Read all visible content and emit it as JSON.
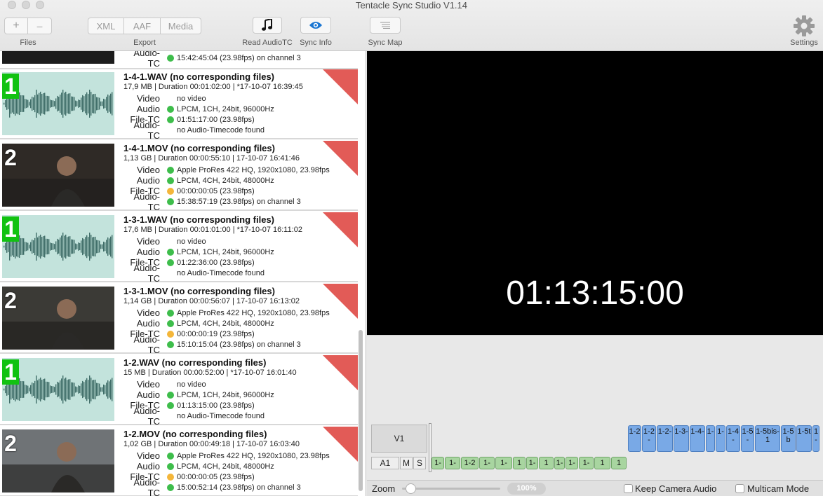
{
  "window": {
    "title": "Tentacle Sync Studio V1.14"
  },
  "toolbar": {
    "files": {
      "add": "+",
      "remove": "–",
      "label": "Files"
    },
    "export": {
      "xml": "XML",
      "aaf": "AAF",
      "media": "Media",
      "label": "Export"
    },
    "read_audiotc": {
      "label": "Read AudioTC",
      "icon": "music-note-icon"
    },
    "sync_info": {
      "label": "Sync Info",
      "icon": "eye-icon"
    },
    "sync_map": {
      "label": "Sync Map",
      "icon": "list-icon"
    },
    "settings": {
      "label": "Settings",
      "icon": "gear-icon"
    }
  },
  "files": {
    "partial": {
      "key": "Audio-TC",
      "value": "15:42:45:04 (23.98fps) on channel 3"
    },
    "items": [
      {
        "badge": "1",
        "kind": "audio",
        "name": "1-4-1.WAV (no corresponding files)",
        "meta": "17,9 MB | Duration 00:01:02:00 | *17-10-07 16:39:45",
        "props": [
          {
            "key": "Video",
            "value": "no video",
            "status": "none"
          },
          {
            "key": "Audio",
            "value": "LPCM, 1CH, 24bit, 96000Hz",
            "status": "green"
          },
          {
            "key": "File-TC",
            "value": "01:51:17:00 (23.98fps)",
            "status": "green"
          },
          {
            "key": "Audio-TC",
            "value": "no Audio-Timecode found",
            "status": "none"
          }
        ]
      },
      {
        "badge": "2",
        "kind": "video",
        "name": "1-4-1.MOV (no corresponding files)",
        "meta": "1,13 GB | Duration 00:00:55:10 | 17-10-07 16:41:46",
        "props": [
          {
            "key": "Video",
            "value": "Apple ProRes 422 HQ, 1920x1080, 23.98fps",
            "status": "green"
          },
          {
            "key": "Audio",
            "value": "LPCM, 4CH, 24bit, 48000Hz",
            "status": "green"
          },
          {
            "key": "File-TC",
            "value": "00:00:00:05 (23.98fps)",
            "status": "orange"
          },
          {
            "key": "Audio-TC",
            "value": "15:38:57:19 (23.98fps) on channel 3",
            "status": "green"
          }
        ]
      },
      {
        "badge": "1",
        "kind": "audio",
        "name": "1-3-1.WAV (no corresponding files)",
        "meta": "17,6 MB | Duration 00:01:01:00 | *17-10-07 16:11:02",
        "props": [
          {
            "key": "Video",
            "value": "no video",
            "status": "none"
          },
          {
            "key": "Audio",
            "value": "LPCM, 1CH, 24bit, 96000Hz",
            "status": "green"
          },
          {
            "key": "File-TC",
            "value": "01:22:36:00 (23.98fps)",
            "status": "green"
          },
          {
            "key": "Audio-TC",
            "value": "no Audio-Timecode found",
            "status": "none"
          }
        ]
      },
      {
        "badge": "2",
        "kind": "video",
        "name": "1-3-1.MOV (no corresponding files)",
        "meta": "1,14 GB | Duration 00:00:56:07 | 17-10-07 16:13:02",
        "props": [
          {
            "key": "Video",
            "value": "Apple ProRes 422 HQ, 1920x1080, 23.98fps",
            "status": "green"
          },
          {
            "key": "Audio",
            "value": "LPCM, 4CH, 24bit, 48000Hz",
            "status": "green"
          },
          {
            "key": "File-TC",
            "value": "00:00:00:19 (23.98fps)",
            "status": "orange"
          },
          {
            "key": "Audio-TC",
            "value": "15:10:15:04 (23.98fps) on channel 3",
            "status": "green"
          }
        ]
      },
      {
        "badge": "1",
        "kind": "audio",
        "name": "1-2.WAV (no corresponding files)",
        "meta": "15 MB | Duration 00:00:52:00 | *17-10-07 16:01:40",
        "props": [
          {
            "key": "Video",
            "value": "no video",
            "status": "none"
          },
          {
            "key": "Audio",
            "value": "LPCM, 1CH, 24bit, 96000Hz",
            "status": "green"
          },
          {
            "key": "File-TC",
            "value": "01:13:15:00 (23.98fps)",
            "status": "green"
          },
          {
            "key": "Audio-TC",
            "value": "no Audio-Timecode found",
            "status": "none"
          }
        ]
      },
      {
        "badge": "2",
        "kind": "video",
        "name": "1-2.MOV (no corresponding files)",
        "meta": "1,02 GB | Duration 00:00:49:18 | 17-10-07 16:03:40",
        "props": [
          {
            "key": "Video",
            "value": "Apple ProRes 422 HQ, 1920x1080, 23.98fps",
            "status": "green"
          },
          {
            "key": "Audio",
            "value": "LPCM, 4CH, 24bit, 48000Hz",
            "status": "green"
          },
          {
            "key": "File-TC",
            "value": "00:00:00:05 (23.98fps)",
            "status": "orange"
          },
          {
            "key": "Audio-TC",
            "value": "15:00:52:14 (23.98fps) on channel 3",
            "status": "green"
          }
        ]
      }
    ]
  },
  "preview": {
    "timecode": "01:13:15:00"
  },
  "timeline": {
    "video_track": "V1",
    "audio_track": "A1",
    "mute": "M",
    "solo": "S",
    "video_clips": [
      "1-2",
      "1-2-",
      "1-2-",
      "1-3-",
      "1-4-",
      "1-",
      "1-",
      "1-4-",
      "1-5-",
      "1-5bis-1",
      "1-5b",
      "1-5t",
      "1-"
    ],
    "audio_clips": [
      "1-",
      "1-",
      "1-2",
      "1-",
      "1-",
      "1",
      "1-",
      "1",
      "1-",
      "1-",
      "1-",
      "1",
      "1"
    ]
  },
  "bottombar": {
    "zoom_label": "Zoom",
    "zoom_value": "100%",
    "zoom_level": 0.04,
    "keep_camera_audio": "Keep Camera Audio",
    "multicam_mode": "Multicam Mode"
  },
  "colors": {
    "green_status": "#3ebd4b",
    "orange_status": "#f4b63a",
    "badge_green": "#11c211",
    "corner_red": "#e25b57",
    "video_clip": "#79a9e6",
    "audio_clip": "#a8d5a0"
  }
}
